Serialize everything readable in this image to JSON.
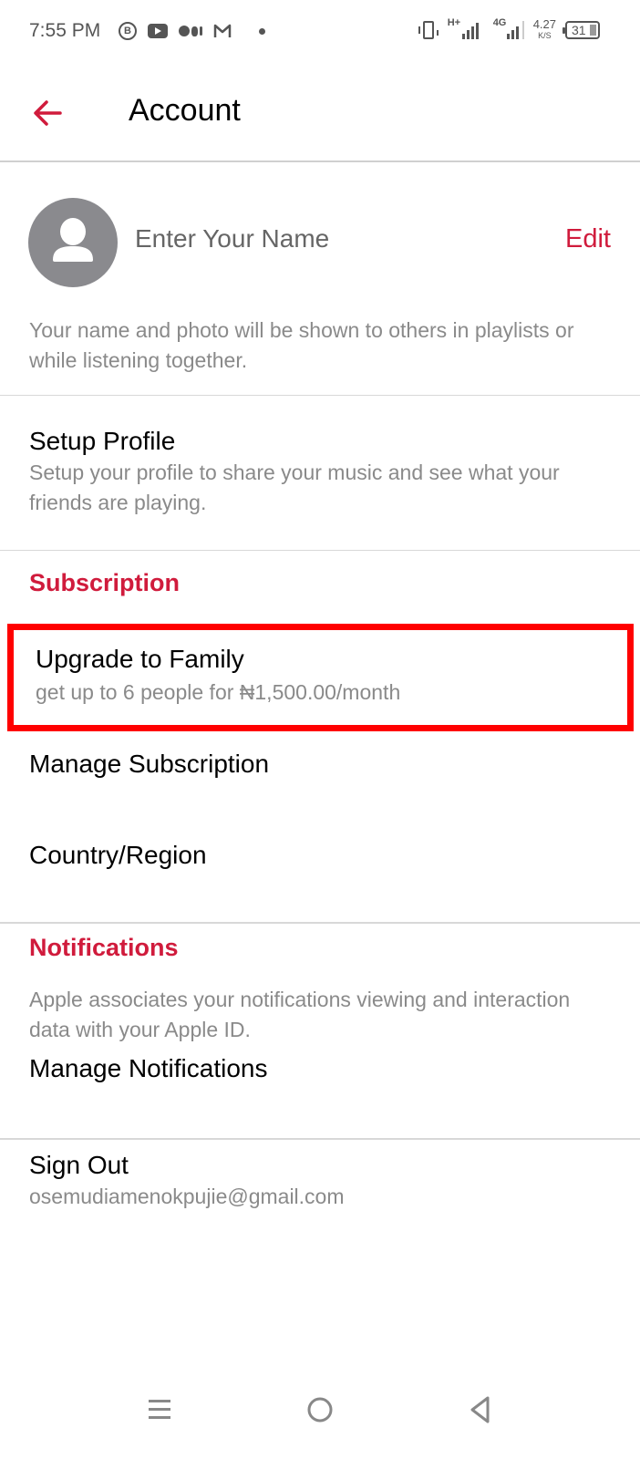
{
  "status_bar": {
    "time": "7:55 PM",
    "notification_icons": [
      "business-chat-icon",
      "youtube-icon",
      "medium-icon",
      "gmail-icon",
      "more-dot-icon"
    ],
    "network_type_1": "H+",
    "network_type_2": "4G",
    "net_speed_value": "4.27",
    "net_speed_unit": "K/S",
    "battery_level": "31"
  },
  "header": {
    "back_icon": "arrow-left-icon",
    "title": "Account"
  },
  "profile": {
    "name_placeholder": "Enter Your Name",
    "edit_label": "Edit",
    "description": "Your name and photo will be shown to others in playlists or while listening together."
  },
  "setup_profile": {
    "title": "Setup Profile",
    "subtitle": "Setup your profile to share your music and see what your friends are playing."
  },
  "subscription": {
    "heading": "Subscription",
    "upgrade_title": "Upgrade to Family",
    "upgrade_subtitle": "get up to 6 people for ₦1,500.00/month",
    "manage_label": "Manage Subscription",
    "country_label": "Country/Region"
  },
  "notifications": {
    "heading": "Notifications",
    "description": "Apple associates your notifications viewing and interaction data with your Apple ID.",
    "manage_label": "Manage Notifications"
  },
  "sign_out": {
    "title": "Sign Out",
    "email": "osemudiamenokpujie@gmail.com"
  },
  "colors": {
    "accent": "#d01b3c",
    "highlight_box": "#ff0000",
    "secondary_text": "#8a8a8a",
    "avatar_bg": "#8a8a8e"
  },
  "nav_bar": {
    "buttons": [
      "recent-apps-icon",
      "home-icon",
      "back-triangle-icon"
    ]
  }
}
